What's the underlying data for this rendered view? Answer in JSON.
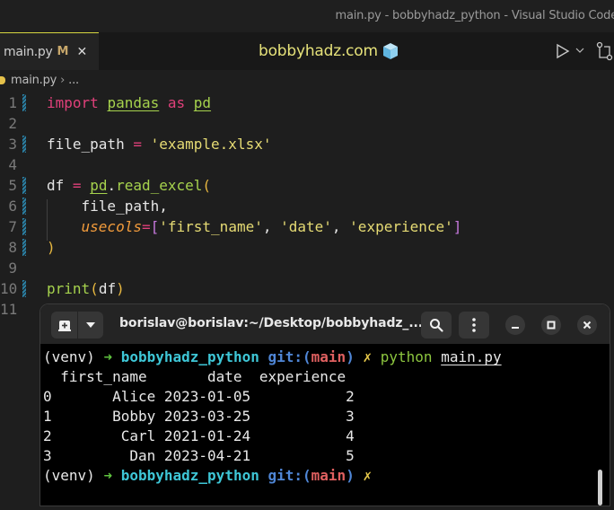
{
  "window": {
    "title": "main.py - bobbyhadz_python - Visual Studio Code"
  },
  "tabs": [
    {
      "label": "main.py",
      "status": "M",
      "close_label": "✕",
      "active": true
    }
  ],
  "brand": {
    "text": "bobbyhadz.com",
    "icon": "cube-icon"
  },
  "toolbar": {
    "run_icon": "run-icon",
    "run_dropdown_icon": "chevron-down-icon",
    "scm_icon": "source-control-icon"
  },
  "breadcrumb": {
    "file": "main.py",
    "separator": "›",
    "more": "..."
  },
  "editor": {
    "lines": [
      {
        "n": "1",
        "tokens": [
          [
            "kw",
            "import"
          ],
          [
            "plain",
            " "
          ],
          [
            "mod",
            "pandas"
          ],
          [
            "plain",
            " "
          ],
          [
            "kw",
            "as"
          ],
          [
            "plain",
            " "
          ],
          [
            "mod",
            "pd"
          ]
        ],
        "modified": true
      },
      {
        "n": "2",
        "tokens": [],
        "modified": false
      },
      {
        "n": "3",
        "tokens": [
          [
            "plain",
            "file_path "
          ],
          [
            "op",
            "="
          ],
          [
            "plain",
            " "
          ],
          [
            "str",
            "'example.xlsx'"
          ]
        ],
        "modified": true
      },
      {
        "n": "4",
        "tokens": [],
        "modified": false
      },
      {
        "n": "5",
        "tokens": [
          [
            "plain",
            "df "
          ],
          [
            "op",
            "="
          ],
          [
            "plain",
            " "
          ],
          [
            "mod",
            "pd"
          ],
          [
            "plain",
            "."
          ],
          [
            "fn",
            "read_excel"
          ],
          [
            "paren",
            "("
          ]
        ],
        "modified": true
      },
      {
        "n": "6",
        "tokens": [
          [
            "plain",
            "    file_path,"
          ]
        ],
        "modified": true
      },
      {
        "n": "7",
        "tokens": [
          [
            "plain",
            "    "
          ],
          [
            "param",
            "usecols"
          ],
          [
            "op",
            "="
          ],
          [
            "brk",
            "["
          ],
          [
            "str",
            "'first_name'"
          ],
          [
            "plain",
            ", "
          ],
          [
            "str",
            "'date'"
          ],
          [
            "plain",
            ", "
          ],
          [
            "str",
            "'experience'"
          ],
          [
            "brk",
            "]"
          ]
        ],
        "modified": true
      },
      {
        "n": "8",
        "tokens": [
          [
            "paren",
            ")"
          ]
        ],
        "modified": true
      },
      {
        "n": "9",
        "tokens": [],
        "modified": false
      },
      {
        "n": "10",
        "tokens": [
          [
            "fn",
            "print"
          ],
          [
            "paren",
            "("
          ],
          [
            "plain",
            "df"
          ],
          [
            "paren",
            ")"
          ]
        ],
        "modified": true
      },
      {
        "n": "11",
        "tokens": [],
        "modified": false
      }
    ]
  },
  "terminal": {
    "title": "borislav@borislav:~/Desktop/bobbyhadz_...",
    "prompt": {
      "venv": "(venv) ",
      "arrow": "➜",
      "dir": "bobbyhadz_python",
      "git_prefix": "git:(",
      "branch": "main",
      "git_suffix": ")",
      "dirty": "✗"
    },
    "command": "python",
    "command_arg": "main.py",
    "output": {
      "header": "  first_name       date  experience",
      "rows": [
        {
          "index": "0",
          "first_name": "Alice",
          "date": "2023-01-05",
          "experience": "2"
        },
        {
          "index": "1",
          "first_name": "Bobby",
          "date": "2023-03-25",
          "experience": "3"
        },
        {
          "index": "2",
          "first_name": "Carl",
          "date": "2021-01-24",
          "experience": "4"
        },
        {
          "index": "3",
          "first_name": "Dan",
          "date": "2023-04-21",
          "experience": "5"
        }
      ]
    }
  }
}
